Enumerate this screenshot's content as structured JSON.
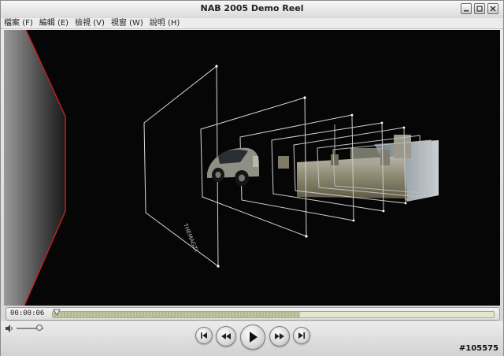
{
  "window": {
    "title": "NAB 2005 Demo Reel"
  },
  "menu": [
    {
      "label": "檔案",
      "accel": "(F)"
    },
    {
      "label": "編輯",
      "accel": "(E)"
    },
    {
      "label": "檢視",
      "accel": "(V)"
    },
    {
      "label": "視窗",
      "accel": "(W)"
    },
    {
      "label": "說明",
      "accel": "(H)"
    }
  ],
  "video": {
    "overlay_text": "THEMAGZY"
  },
  "timebar": {
    "timecode": "00:00:06",
    "position": 0.011,
    "loaded": 0.56
  },
  "volume": {
    "level": 0.85
  },
  "controls": {
    "buttons": [
      "go-to-start-icon",
      "rewind-icon",
      "play-icon",
      "fast-forward-icon",
      "go-to-end-icon"
    ]
  },
  "badge": "#105575",
  "colors": {
    "video_bg": "#060606",
    "accent_edge": "#c02020",
    "track": "#c2c6a0"
  }
}
